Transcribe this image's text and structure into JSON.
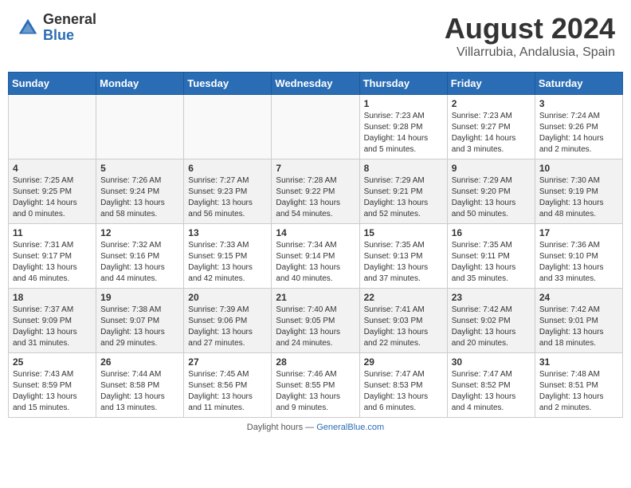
{
  "header": {
    "logo_general": "General",
    "logo_blue": "Blue",
    "month": "August 2024",
    "location": "Villarrubia, Andalusia, Spain"
  },
  "weekdays": [
    "Sunday",
    "Monday",
    "Tuesday",
    "Wednesday",
    "Thursday",
    "Friday",
    "Saturday"
  ],
  "weeks": [
    [
      {
        "day": "",
        "info": ""
      },
      {
        "day": "",
        "info": ""
      },
      {
        "day": "",
        "info": ""
      },
      {
        "day": "",
        "info": ""
      },
      {
        "day": "1",
        "info": "Sunrise: 7:23 AM\nSunset: 9:28 PM\nDaylight: 14 hours\nand 5 minutes."
      },
      {
        "day": "2",
        "info": "Sunrise: 7:23 AM\nSunset: 9:27 PM\nDaylight: 14 hours\nand 3 minutes."
      },
      {
        "day": "3",
        "info": "Sunrise: 7:24 AM\nSunset: 9:26 PM\nDaylight: 14 hours\nand 2 minutes."
      }
    ],
    [
      {
        "day": "4",
        "info": "Sunrise: 7:25 AM\nSunset: 9:25 PM\nDaylight: 14 hours\nand 0 minutes."
      },
      {
        "day": "5",
        "info": "Sunrise: 7:26 AM\nSunset: 9:24 PM\nDaylight: 13 hours\nand 58 minutes."
      },
      {
        "day": "6",
        "info": "Sunrise: 7:27 AM\nSunset: 9:23 PM\nDaylight: 13 hours\nand 56 minutes."
      },
      {
        "day": "7",
        "info": "Sunrise: 7:28 AM\nSunset: 9:22 PM\nDaylight: 13 hours\nand 54 minutes."
      },
      {
        "day": "8",
        "info": "Sunrise: 7:29 AM\nSunset: 9:21 PM\nDaylight: 13 hours\nand 52 minutes."
      },
      {
        "day": "9",
        "info": "Sunrise: 7:29 AM\nSunset: 9:20 PM\nDaylight: 13 hours\nand 50 minutes."
      },
      {
        "day": "10",
        "info": "Sunrise: 7:30 AM\nSunset: 9:19 PM\nDaylight: 13 hours\nand 48 minutes."
      }
    ],
    [
      {
        "day": "11",
        "info": "Sunrise: 7:31 AM\nSunset: 9:17 PM\nDaylight: 13 hours\nand 46 minutes."
      },
      {
        "day": "12",
        "info": "Sunrise: 7:32 AM\nSunset: 9:16 PM\nDaylight: 13 hours\nand 44 minutes."
      },
      {
        "day": "13",
        "info": "Sunrise: 7:33 AM\nSunset: 9:15 PM\nDaylight: 13 hours\nand 42 minutes."
      },
      {
        "day": "14",
        "info": "Sunrise: 7:34 AM\nSunset: 9:14 PM\nDaylight: 13 hours\nand 40 minutes."
      },
      {
        "day": "15",
        "info": "Sunrise: 7:35 AM\nSunset: 9:13 PM\nDaylight: 13 hours\nand 37 minutes."
      },
      {
        "day": "16",
        "info": "Sunrise: 7:35 AM\nSunset: 9:11 PM\nDaylight: 13 hours\nand 35 minutes."
      },
      {
        "day": "17",
        "info": "Sunrise: 7:36 AM\nSunset: 9:10 PM\nDaylight: 13 hours\nand 33 minutes."
      }
    ],
    [
      {
        "day": "18",
        "info": "Sunrise: 7:37 AM\nSunset: 9:09 PM\nDaylight: 13 hours\nand 31 minutes."
      },
      {
        "day": "19",
        "info": "Sunrise: 7:38 AM\nSunset: 9:07 PM\nDaylight: 13 hours\nand 29 minutes."
      },
      {
        "day": "20",
        "info": "Sunrise: 7:39 AM\nSunset: 9:06 PM\nDaylight: 13 hours\nand 27 minutes."
      },
      {
        "day": "21",
        "info": "Sunrise: 7:40 AM\nSunset: 9:05 PM\nDaylight: 13 hours\nand 24 minutes."
      },
      {
        "day": "22",
        "info": "Sunrise: 7:41 AM\nSunset: 9:03 PM\nDaylight: 13 hours\nand 22 minutes."
      },
      {
        "day": "23",
        "info": "Sunrise: 7:42 AM\nSunset: 9:02 PM\nDaylight: 13 hours\nand 20 minutes."
      },
      {
        "day": "24",
        "info": "Sunrise: 7:42 AM\nSunset: 9:01 PM\nDaylight: 13 hours\nand 18 minutes."
      }
    ],
    [
      {
        "day": "25",
        "info": "Sunrise: 7:43 AM\nSunset: 8:59 PM\nDaylight: 13 hours\nand 15 minutes."
      },
      {
        "day": "26",
        "info": "Sunrise: 7:44 AM\nSunset: 8:58 PM\nDaylight: 13 hours\nand 13 minutes."
      },
      {
        "day": "27",
        "info": "Sunrise: 7:45 AM\nSunset: 8:56 PM\nDaylight: 13 hours\nand 11 minutes."
      },
      {
        "day": "28",
        "info": "Sunrise: 7:46 AM\nSunset: 8:55 PM\nDaylight: 13 hours\nand 9 minutes."
      },
      {
        "day": "29",
        "info": "Sunrise: 7:47 AM\nSunset: 8:53 PM\nDaylight: 13 hours\nand 6 minutes."
      },
      {
        "day": "30",
        "info": "Sunrise: 7:47 AM\nSunset: 8:52 PM\nDaylight: 13 hours\nand 4 minutes."
      },
      {
        "day": "31",
        "info": "Sunrise: 7:48 AM\nSunset: 8:51 PM\nDaylight: 13 hours\nand 2 minutes."
      }
    ]
  ],
  "footer": {
    "note": "Daylight hours",
    "source": "GeneralBlue.com"
  }
}
